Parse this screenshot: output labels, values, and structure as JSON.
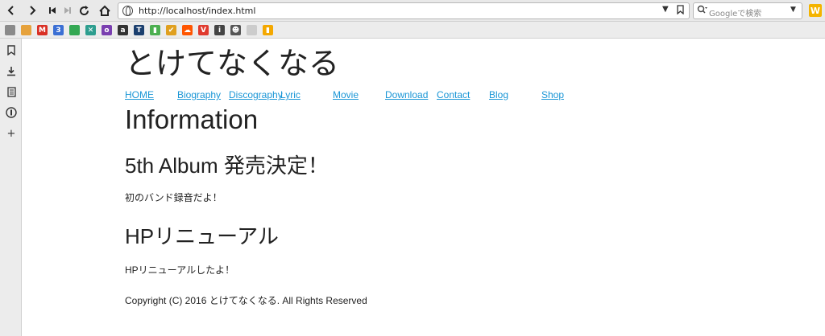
{
  "browser": {
    "url": "http://localhost/index.html",
    "search_placeholder": "Googleで検索",
    "toolbar_icons": [
      "back-icon",
      "forward-icon",
      "skip-back-icon",
      "skip-forward-icon",
      "reload-icon",
      "home-icon"
    ],
    "extension_letter": "W"
  },
  "bookmarks_bar": {
    "icons": [
      {
        "name": "folder-icon",
        "color": "#8a8a8a",
        "glyph": ""
      },
      {
        "name": "smiley-icon",
        "color": "#e6a23c",
        "glyph": ""
      },
      {
        "name": "gmail-icon",
        "color": "#d93025",
        "glyph": "M"
      },
      {
        "name": "calendar-icon",
        "color": "#3b6fd4",
        "glyph": "3"
      },
      {
        "name": "maps-icon",
        "color": "#34a853",
        "glyph": ""
      },
      {
        "name": "tool-icon",
        "color": "#2e9e8f",
        "glyph": "✕"
      },
      {
        "name": "purple-app-icon",
        "color": "#7a3fb0",
        "glyph": "o"
      },
      {
        "name": "amazon-icon",
        "color": "#333333",
        "glyph": "a"
      },
      {
        "name": "t-icon",
        "color": "#1b3f6e",
        "glyph": "T"
      },
      {
        "name": "bars-icon",
        "color": "#4caf50",
        "glyph": "▮"
      },
      {
        "name": "check-icon",
        "color": "#e0a020",
        "glyph": "✔"
      },
      {
        "name": "soundcloud-icon",
        "color": "#ff5500",
        "glyph": "☁"
      },
      {
        "name": "vivaldi-icon",
        "color": "#e03a2e",
        "glyph": "V"
      },
      {
        "name": "info-icon",
        "color": "#444444",
        "glyph": "i"
      },
      {
        "name": "mask-icon",
        "color": "#555555",
        "glyph": "☻"
      },
      {
        "name": "page-icon",
        "color": "#cccccc",
        "glyph": ""
      },
      {
        "name": "analytics-icon",
        "color": "#f4a800",
        "glyph": "▮"
      }
    ]
  },
  "sidebar": {
    "icons": [
      "bookmark-icon",
      "download-icon",
      "notes-icon",
      "info-icon",
      "add-icon"
    ]
  },
  "page": {
    "site_title": "とけてなくなる",
    "nav": [
      "HOME",
      "Biography",
      "Discography",
      "Lyric",
      "Movie",
      "Download",
      "Contact",
      "Blog",
      "Shop"
    ],
    "section_title": "Information",
    "posts": [
      {
        "title": "5th Album 発売決定！",
        "body": "初のバンド録音だよ！"
      },
      {
        "title": "HPリニューアル",
        "body": "HPリニューアルしたよ！"
      }
    ],
    "copyright": "Copyright (C) 2016 とけてなくなる. All Rights Reserved"
  }
}
